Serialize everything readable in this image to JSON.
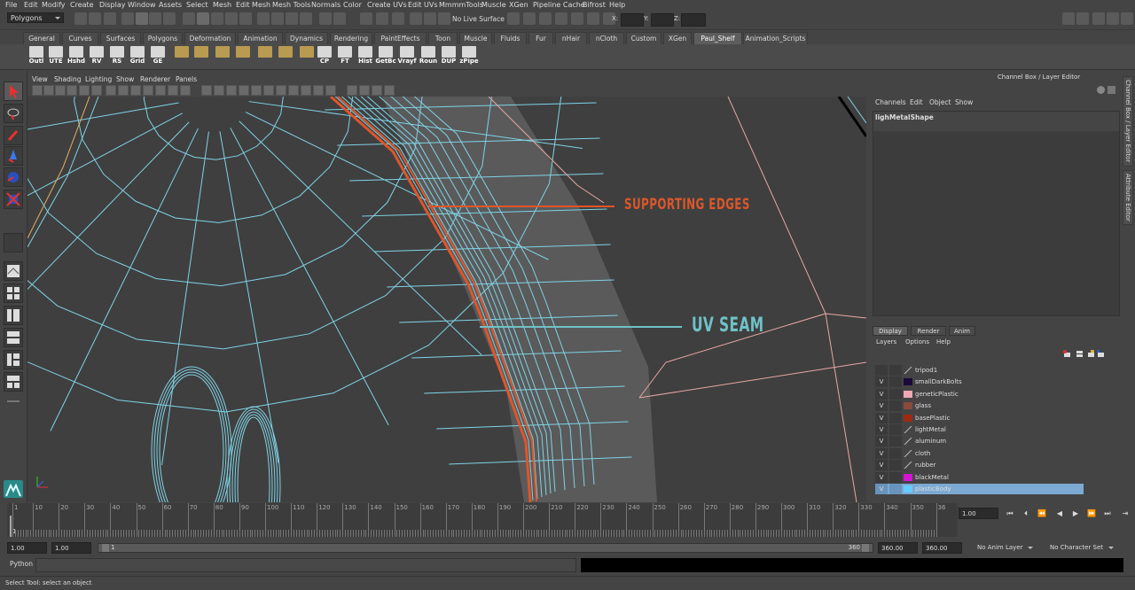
{
  "menubar": [
    "File",
    "Edit",
    "Modify",
    "Create",
    "Display",
    "Window",
    "Assets",
    "Select",
    "Mesh",
    "Edit Mesh",
    "Mesh Tools",
    "Normals",
    "Color",
    "Create UVs",
    "Edit UVs",
    "MmmmTools",
    "Muscle",
    "XGen",
    "Pipeline Cache",
    "Bifrost",
    "Help"
  ],
  "status": {
    "mode": "Polygons",
    "live_surface": "No Live Surface",
    "coord_labels": [
      "X:",
      "Y:",
      "Z:"
    ]
  },
  "shelf_tabs": [
    "General",
    "Curves",
    "Surfaces",
    "Polygons",
    "Deformation",
    "Animation",
    "Dynamics",
    "Rendering",
    "PaintEffects",
    "Toon",
    "Muscle",
    "Fluids",
    "Fur",
    "nHair",
    "nCloth",
    "Custom",
    "XGen",
    "Paul_Shelf",
    "Animation_Scripts"
  ],
  "active_shelf_tab": "Paul_Shelf",
  "shelf_buttons": [
    "Outl",
    "UTE",
    "Hshd",
    "RV",
    "RS",
    "Grid",
    "GE",
    "",
    "",
    "",
    "",
    "",
    "",
    "",
    "CP",
    "FT",
    "Hist",
    "GetBc",
    "Vrayf",
    "Roun",
    "DUP",
    "zPipe"
  ],
  "viewport": {
    "menu": [
      "View",
      "Shading",
      "Lighting",
      "Show",
      "Renderer",
      "Panels"
    ],
    "annotations": {
      "supporting": {
        "text": "SUPPORTING EDGES",
        "color": "#d9572b"
      },
      "seam": {
        "text": "UV SEAM",
        "color": "#6fc1c6"
      }
    },
    "colors": {
      "wire": "#7fd3e6",
      "seam": "#e0552a",
      "pink_wire": "#e8a7a5",
      "face": "#5a5a5a",
      "bg": "#3f3f3f"
    }
  },
  "channel_box": {
    "title": "Channel Box / Layer Editor",
    "menu": [
      "Channels",
      "Edit",
      "Object",
      "Show"
    ],
    "object": "lighMetalShape"
  },
  "layer_editor": {
    "tabs": [
      "Display",
      "Render",
      "Anim"
    ],
    "active_tab": "Display",
    "menu": [
      "Layers",
      "Options",
      "Help"
    ],
    "layers": [
      {
        "v": "",
        "name": "tripod1",
        "color": "",
        "selected": false
      },
      {
        "v": "V",
        "name": "smallDarkBolts",
        "color": "#1a0a3a",
        "selected": false
      },
      {
        "v": "V",
        "name": "geneticPlastic",
        "color": "#f0a8b8",
        "selected": false
      },
      {
        "v": "V",
        "name": "glass",
        "color": "#8a4a3c",
        "selected": false
      },
      {
        "v": "V",
        "name": "basePlastic",
        "color": "#9b2a10",
        "selected": false
      },
      {
        "v": "V",
        "name": "lightMetal",
        "color": "",
        "selected": false
      },
      {
        "v": "V",
        "name": "aluminum",
        "color": "",
        "selected": false
      },
      {
        "v": "V",
        "name": "cloth",
        "color": "",
        "selected": false
      },
      {
        "v": "V",
        "name": "rubber",
        "color": "",
        "selected": false
      },
      {
        "v": "V",
        "name": "blackMetal",
        "color": "#d414d4",
        "selected": false
      },
      {
        "v": "V",
        "name": "plasticBody",
        "color": "#66ccff",
        "selected": true
      }
    ]
  },
  "side_tabs": [
    "Channel Box / Layer Editor",
    "Attribute Editor"
  ],
  "timeline": {
    "ticks": [
      "1",
      "10",
      "20",
      "30",
      "40",
      "50",
      "60",
      "70",
      "80",
      "90",
      "100",
      "110",
      "120",
      "130",
      "140",
      "150",
      "160",
      "170",
      "180",
      "190",
      "200",
      "210",
      "220",
      "230",
      "240",
      "250",
      "260",
      "270",
      "280",
      "290",
      "300",
      "310",
      "320",
      "330",
      "340",
      "350",
      "36"
    ],
    "current_frame": "1",
    "current_field": "1.00"
  },
  "range": {
    "start": "1.00",
    "anim_start": "1.00",
    "slider_left": "1",
    "slider_right": "360",
    "anim_end": "360.00",
    "end": "360.00",
    "anim_layer": "No Anim Layer",
    "character_set": "No Character Set"
  },
  "command_line": {
    "label": "Python"
  },
  "help_line": "Select Tool: select an object"
}
